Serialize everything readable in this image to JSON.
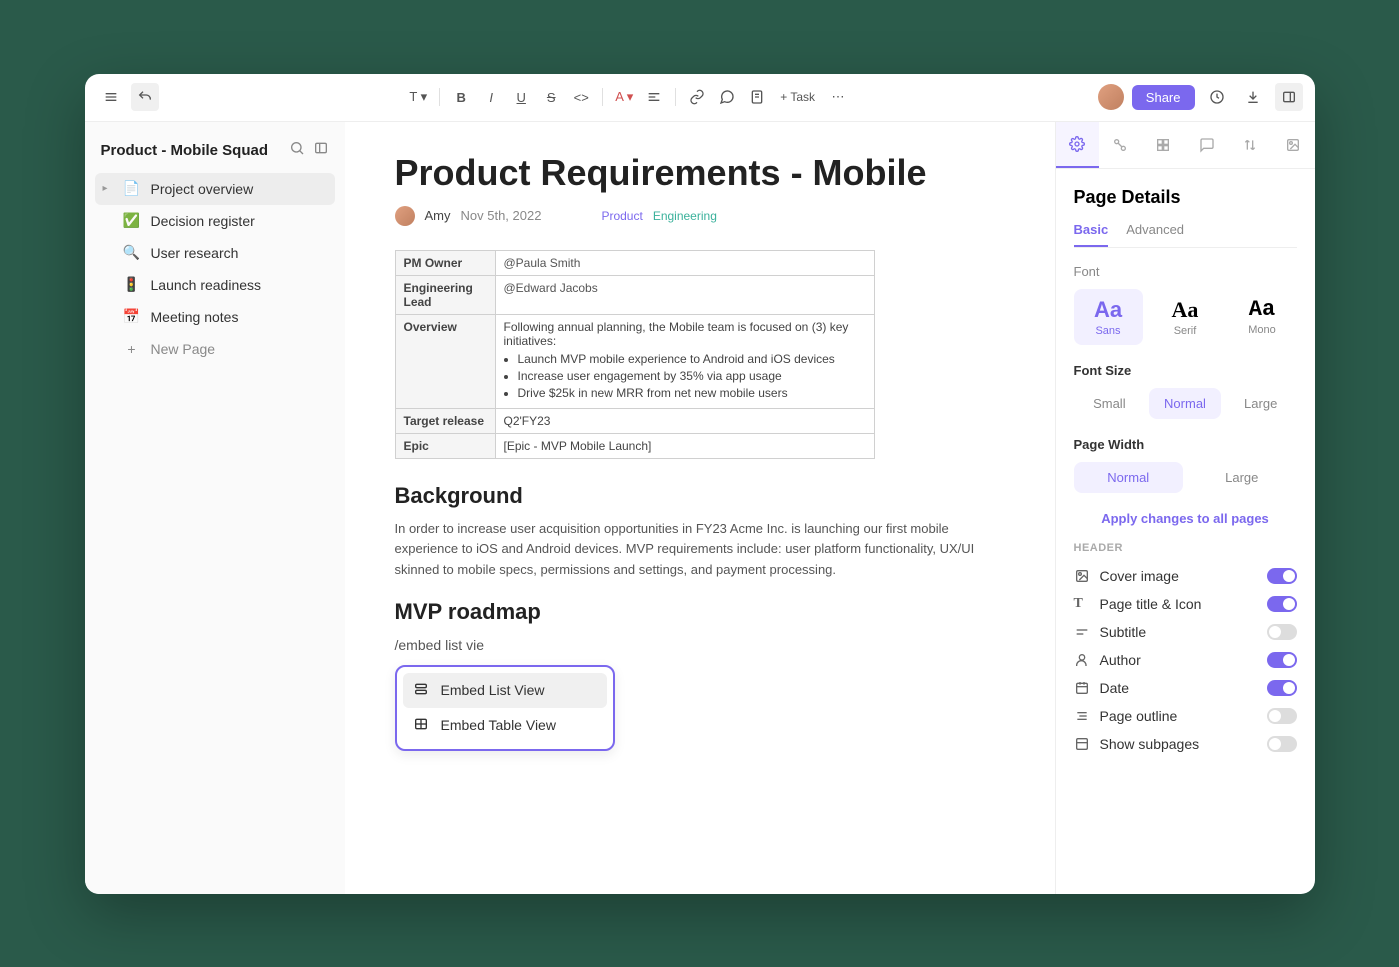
{
  "topbar": {
    "task_label": "+ Task",
    "share_label": "Share"
  },
  "sidebar": {
    "space_title": "Product - Mobile Squad",
    "items": [
      {
        "icon": "📄",
        "label": "Project overview",
        "active": true,
        "caret": true
      },
      {
        "icon": "✅",
        "label": "Decision register"
      },
      {
        "icon": "🔍",
        "label": "User research"
      },
      {
        "icon": "🚦",
        "label": "Launch readiness"
      },
      {
        "icon": "📅",
        "label": "Meeting notes"
      }
    ],
    "new_page_label": "New Page"
  },
  "page": {
    "title": "Product Requirements - Mobile",
    "author": "Amy",
    "date": "Nov 5th, 2022",
    "tags": {
      "product": "Product",
      "engineering": "Engineering"
    },
    "table": {
      "pm_owner_label": "PM Owner",
      "pm_owner_value": "@Paula Smith",
      "eng_lead_label": "Engineering Lead",
      "eng_lead_value": "@Edward Jacobs",
      "overview_label": "Overview",
      "overview_intro": "Following annual planning, the Mobile team is focused on (3) key initiatives:",
      "overview_bullets": [
        "Launch MVP mobile experience to Android and iOS devices",
        "Increase user engagement by 35% via app usage",
        "Drive $25k in new MRR from net new mobile users"
      ],
      "target_label": "Target release",
      "target_value": "Q2'FY23",
      "epic_label": "Epic",
      "epic_value": "[Epic - MVP Mobile Launch]"
    },
    "background_heading": "Background",
    "background_text": "In order to increase user acquisition opportunities in FY23 Acme Inc. is launching our first mobile experience to iOS and Android devices. MVP requirements include: user platform functionality, UX/UI skinned to mobile specs, permissions and settings, and payment processing.",
    "roadmap_heading": "MVP roadmap",
    "slash_command": "/embed list vie",
    "embed_menu": {
      "list_view": "Embed List View",
      "table_view": "Embed Table View"
    }
  },
  "panel": {
    "title": "Page Details",
    "tabs": {
      "basic": "Basic",
      "advanced": "Advanced"
    },
    "font_label": "Font",
    "fonts": {
      "sans": "Sans",
      "serif": "Serif",
      "mono": "Mono"
    },
    "font_size_label": "Font Size",
    "sizes": {
      "small": "Small",
      "normal": "Normal",
      "large": "Large"
    },
    "page_width_label": "Page Width",
    "widths": {
      "normal": "Normal",
      "large": "Large"
    },
    "apply_all": "Apply changes to all pages",
    "header_section": "HEADER",
    "toggles": [
      {
        "label": "Cover image",
        "on": true,
        "icon": "image"
      },
      {
        "label": "Page title & Icon",
        "on": true,
        "icon": "text"
      },
      {
        "label": "Subtitle",
        "on": false,
        "icon": "subtitle"
      },
      {
        "label": "Author",
        "on": true,
        "icon": "author"
      },
      {
        "label": "Date",
        "on": true,
        "icon": "date"
      },
      {
        "label": "Page outline",
        "on": false,
        "icon": "outline"
      },
      {
        "label": "Show subpages",
        "on": false,
        "icon": "subpages"
      }
    ]
  }
}
